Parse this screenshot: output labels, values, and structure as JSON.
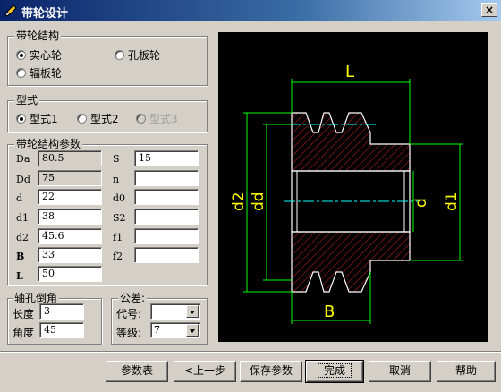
{
  "window": {
    "title": "带轮设计",
    "close_glyph": "×",
    "icon": "pencil-icon"
  },
  "structure_group": {
    "legend": "带轮结构",
    "options": [
      {
        "label": "实心轮",
        "selected": true
      },
      {
        "label": "孔板轮",
        "selected": false
      },
      {
        "label": "辐板轮",
        "selected": false
      }
    ]
  },
  "type_group": {
    "legend": "型式",
    "options": [
      {
        "label": "型式1",
        "selected": true,
        "enabled": true
      },
      {
        "label": "型式2",
        "selected": false,
        "enabled": true
      },
      {
        "label": "型式3",
        "selected": false,
        "enabled": false
      }
    ]
  },
  "params_group": {
    "legend": "带轮结构参数",
    "left": [
      {
        "label": "Da",
        "value": "80.5",
        "readonly": true
      },
      {
        "label": "Dd",
        "value": "75",
        "readonly": true
      },
      {
        "label": "d",
        "value": "22",
        "readonly": false
      },
      {
        "label": "d1",
        "value": "38",
        "readonly": false
      },
      {
        "label": "d2",
        "value": "45.6",
        "readonly": false
      },
      {
        "label": "B",
        "value": "33",
        "readonly": false
      },
      {
        "label": "L",
        "value": "50",
        "readonly": false
      }
    ],
    "right": [
      {
        "label": "S",
        "value": "15"
      },
      {
        "label": "n",
        "value": ""
      },
      {
        "label": "d0",
        "value": ""
      },
      {
        "label": "S2",
        "value": ""
      },
      {
        "label": "f1",
        "value": ""
      },
      {
        "label": "f2",
        "value": ""
      }
    ]
  },
  "chamfer_group": {
    "legend": "轴孔倒角",
    "length_label": "长度",
    "length_value": "3",
    "angle_label": "角度",
    "angle_value": "45"
  },
  "tolerance_group": {
    "legend": "公差:",
    "code_label": "代号:",
    "code_value": "",
    "grade_label": "等级:",
    "grade_value": "7"
  },
  "drawing": {
    "labels": {
      "L": "L",
      "B": "B",
      "d2": "d2",
      "dd": "dd",
      "d": "d",
      "d1": "d1"
    },
    "colors": {
      "outline": "#ffffff",
      "hatch": "#b02020",
      "dimension": "#00ff00",
      "dim_text": "#ffff00",
      "centerline": "#00ffff"
    }
  },
  "buttons": {
    "params_table": "参数表",
    "prev": "<上一步",
    "save_params": "保存参数",
    "finish": "完成",
    "cancel": "取消",
    "help": "帮助"
  }
}
